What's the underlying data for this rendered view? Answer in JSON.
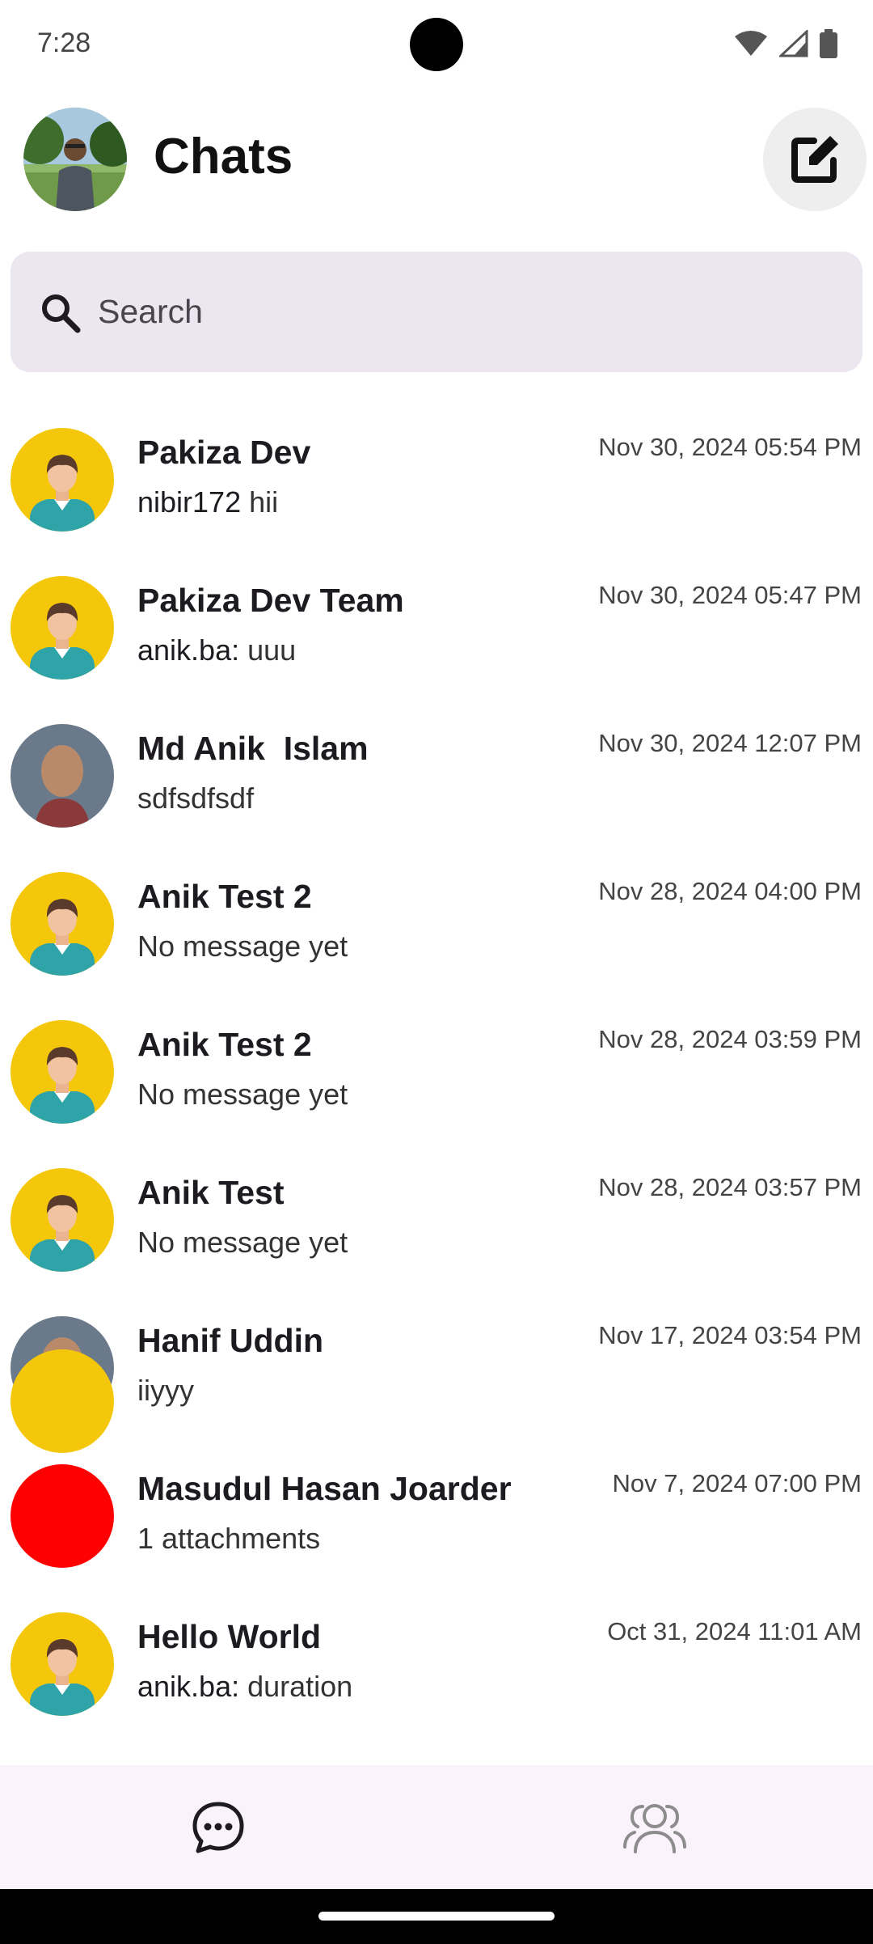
{
  "status_bar": {
    "time": "7:28",
    "icons": [
      "wifi-icon",
      "signal-icon",
      "battery-icon"
    ]
  },
  "header": {
    "title": "Chats",
    "profile_avatar": "profile-photo",
    "compose_icon": "edit-icon"
  },
  "search": {
    "placeholder": "Search",
    "value": ""
  },
  "colors": {
    "search_bg": "#ece6f0",
    "avatar_yellow": "#f5c70a",
    "avatar_red": "#ff0000",
    "nav_bg": "#fbf3fb"
  },
  "chats": [
    {
      "name": "Pakiza Dev",
      "time": "Nov 30, 2024 05:54 PM",
      "sender": "nibir172",
      "message": "hii",
      "avatar": "default-person"
    },
    {
      "name": "Pakiza Dev Team",
      "time": "Nov 30, 2024 05:47 PM",
      "sender": "anik.ba:",
      "message": "uuu",
      "avatar": "default-person"
    },
    {
      "name": "Md Anik  Islam",
      "time": "Nov 30, 2024 12:07 PM",
      "sender": "",
      "message": "sdfsdfsdf",
      "avatar": "photo"
    },
    {
      "name": "Anik Test 2",
      "time": "Nov 28, 2024 04:00 PM",
      "sender": "",
      "message": "No message yet",
      "avatar": "default-person"
    },
    {
      "name": "Anik Test 2",
      "time": "Nov 28, 2024 03:59 PM",
      "sender": "",
      "message": "No message yet",
      "avatar": "default-person"
    },
    {
      "name": "Anik Test",
      "time": "Nov 28, 2024 03:57 PM",
      "sender": "",
      "message": "No message yet",
      "avatar": "default-person"
    },
    {
      "name": "Hanif Uddin",
      "time": "Nov 17, 2024 03:54 PM",
      "sender": "",
      "message": "iiyyy",
      "avatar": "photo"
    },
    {
      "name": "Masudul Hasan Joarder",
      "time": "Nov 7, 2024 07:00 PM",
      "sender": "",
      "message": "1 attachments",
      "avatar": "red-circle"
    },
    {
      "name": "Hello World",
      "time": "Oct 31, 2024 11:01 AM",
      "sender": "anik.ba:",
      "message": "duration",
      "avatar": "default-person"
    }
  ],
  "bottom_nav": {
    "items": [
      {
        "icon": "chat-bubble-icon",
        "active": true
      },
      {
        "icon": "people-icon",
        "active": false
      }
    ]
  }
}
